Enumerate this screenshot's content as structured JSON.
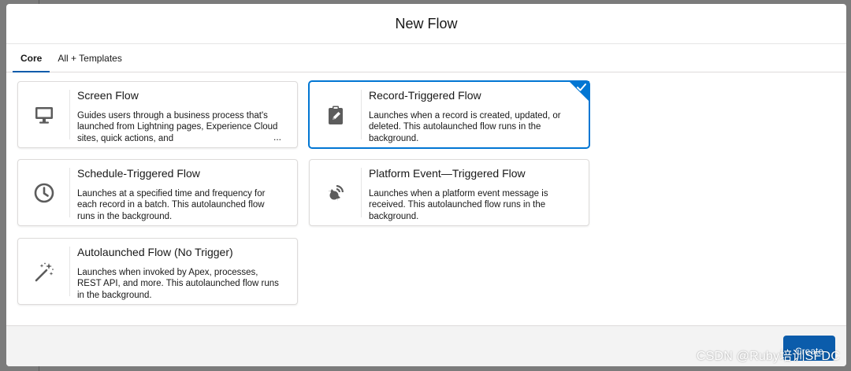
{
  "modal": {
    "title": "New Flow"
  },
  "tabs": [
    {
      "label": "Core",
      "active": true
    },
    {
      "label": "All + Templates",
      "active": false
    }
  ],
  "cards": [
    {
      "title": "Screen Flow",
      "description": "Guides users through a business process that's launched from Lightning pages, Experience Cloud sites, quick actions, and",
      "ellipsis": "...",
      "icon": "desktop-icon",
      "selected": false
    },
    {
      "title": "Record-Triggered Flow",
      "description": "Launches when a record is created, updated, or deleted. This autolaunched flow runs in the background.",
      "icon": "clipboard-edit-icon",
      "selected": true
    },
    {
      "title": "Schedule-Triggered Flow",
      "description": "Launches at a specified time and frequency for each record in a batch. This autolaunched flow runs in the background.",
      "icon": "clock-icon",
      "selected": false
    },
    {
      "title": "Platform Event—Triggered Flow",
      "description": "Launches when a platform event message is received. This autolaunched flow runs in the background.",
      "icon": "broadcast-icon",
      "selected": false
    },
    {
      "title": "Autolaunched Flow (No Trigger)",
      "description": "Launches when invoked by Apex, processes, REST API, and more. This autolaunched flow runs in the background.",
      "icon": "magic-wand-icon",
      "selected": false
    }
  ],
  "footer": {
    "create_label": "Create"
  },
  "watermark": "CSDN @Ruby培训SFDC",
  "colors": {
    "brand": "#0b5cab",
    "selected_border": "#0176d3",
    "icon": "#5c5c5c"
  }
}
